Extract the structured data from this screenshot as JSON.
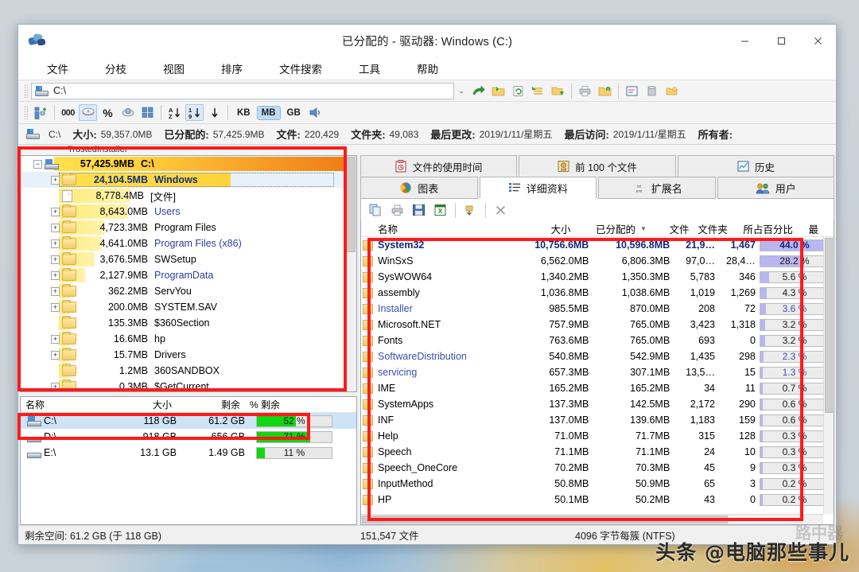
{
  "window": {
    "title": "已分配的 - 驱动器: Windows (C:)",
    "minimize": "—",
    "maximize": "□",
    "close": "✕"
  },
  "menu": [
    "文件",
    "分枝",
    "视图",
    "排序",
    "文件搜索",
    "工具",
    "帮助"
  ],
  "address": {
    "value": "C:\\",
    "caret": "⌄"
  },
  "toolbar": {
    "units": [
      "KB",
      "MB",
      "GB"
    ],
    "active_unit": "MB",
    "numeric_label": "000"
  },
  "infobar": {
    "drive": "C:\\",
    "size_label": "大小:",
    "size_value": "59,357.0MB",
    "alloc_label": "已分配的:",
    "alloc_value": "57,425.9MB",
    "files_label": "文件:",
    "files_value": "220,429",
    "folders_label": "文件夹:",
    "folders_value": "49,083",
    "modified_label": "最后更改:",
    "modified_value": "2019/1/11/星期五",
    "accessed_label": "最后访问:",
    "accessed_value": "2019/1/11/星期五",
    "owner_label": "所有者:",
    "owner_value": "TrustedInstaller"
  },
  "tree": {
    "root": {
      "size": "57,425.9MB",
      "name": "C:\\",
      "bar_pct": 100
    },
    "items": [
      {
        "size": "24,104.5MB",
        "name": "Windows",
        "bar_pct": 72,
        "expandable": true,
        "selected": true,
        "icon": "folder",
        "link": false
      },
      {
        "size": "8,778.4MB",
        "name": "[文件]",
        "bar_pct": 30,
        "expandable": false,
        "selected": false,
        "icon": "file",
        "link": false
      },
      {
        "size": "8,643.0MB",
        "name": "Users",
        "bar_pct": 29,
        "expandable": true,
        "selected": false,
        "icon": "folder",
        "link": true
      },
      {
        "size": "4,723.3MB",
        "name": "Program Files",
        "bar_pct": 19,
        "expandable": true,
        "selected": false,
        "icon": "folder",
        "link": false
      },
      {
        "size": "4,641.0MB",
        "name": "Program Files (x86)",
        "bar_pct": 18,
        "expandable": true,
        "selected": false,
        "icon": "folder",
        "link": true
      },
      {
        "size": "3,676.5MB",
        "name": "SWSetup",
        "bar_pct": 15,
        "expandable": true,
        "selected": false,
        "icon": "folder",
        "link": false
      },
      {
        "size": "2,127.9MB",
        "name": "ProgramData",
        "bar_pct": 11,
        "expandable": true,
        "selected": false,
        "icon": "folder",
        "link": true
      },
      {
        "size": "362.2MB",
        "name": "ServYou",
        "bar_pct": 5,
        "expandable": true,
        "selected": false,
        "icon": "folder",
        "link": false
      },
      {
        "size": "200.0MB",
        "name": "SYSTEM.SAV",
        "bar_pct": 4,
        "expandable": true,
        "selected": false,
        "icon": "folder",
        "link": false
      },
      {
        "size": "135.3MB",
        "name": "$360Section",
        "bar_pct": 3,
        "expandable": false,
        "selected": false,
        "icon": "folder",
        "link": false
      },
      {
        "size": "16.6MB",
        "name": "hp",
        "bar_pct": 2,
        "expandable": true,
        "selected": false,
        "icon": "folder",
        "link": false
      },
      {
        "size": "15.7MB",
        "name": "Drivers",
        "bar_pct": 2,
        "expandable": true,
        "selected": false,
        "icon": "folder",
        "link": false
      },
      {
        "size": "1.2MB",
        "name": "360SANDBOX",
        "bar_pct": 1,
        "expandable": false,
        "selected": false,
        "icon": "folder",
        "link": false
      },
      {
        "size": "0.3MB",
        "name": "$GetCurrent",
        "bar_pct": 1,
        "expandable": true,
        "selected": false,
        "icon": "folder",
        "link": false
      }
    ]
  },
  "drive_list": {
    "headers": [
      "名称",
      "大小",
      "剩余",
      "% 剩余"
    ],
    "rows": [
      {
        "name": "C:\\",
        "size": "118 GB",
        "free": "61.2 GB",
        "pct_text": "52 %",
        "pct": 52,
        "selected": true
      },
      {
        "name": "D:\\",
        "size": "918 GB",
        "free": "656 GB",
        "pct_text": "71 %",
        "pct": 71,
        "selected": false
      },
      {
        "name": "E:\\",
        "size": "13.1 GB",
        "free": "1.49 GB",
        "pct_text": "11 %",
        "pct": 11,
        "selected": false
      }
    ]
  },
  "right_panel": {
    "tabs_top": [
      {
        "label": "文件的使用时间",
        "icon": "clipboard-clock-icon"
      },
      {
        "label": "前 100 个文件",
        "icon": "top100-icon"
      },
      {
        "label": "历史",
        "icon": "history-chart-icon"
      }
    ],
    "tabs_main": [
      {
        "label": "图表",
        "icon": "pie-chart-icon",
        "active": false
      },
      {
        "label": "详细资料",
        "icon": "details-list-icon",
        "active": true
      },
      {
        "label": "扩展名",
        "icon": "file-ext-icon",
        "active": false
      },
      {
        "label": "用户",
        "icon": "users-icon",
        "active": false
      }
    ],
    "mini_toolbar": [
      "copy-icon",
      "print-icon",
      "save-icon",
      "excel-icon",
      "export-icon",
      "close-icon"
    ],
    "grid_headers": [
      "名称",
      "大小",
      "已分配的",
      "文件",
      "文件夹",
      "所占百分比",
      "最"
    ],
    "sort_column": "已分配的",
    "sort_glyph": "▼",
    "rows": [
      {
        "name": "System32",
        "size": "10,756.6MB",
        "alloc": "10,596.8MB",
        "files": "21,9…",
        "folders": "1,467",
        "pct_text": "44.0 %",
        "pct": 44.0
      },
      {
        "name": "WinSxS",
        "size": "6,562.0MB",
        "alloc": "6,806.3MB",
        "files": "97,0…",
        "folders": "28,4…",
        "pct_text": "28.2 %",
        "pct": 28.2
      },
      {
        "name": "SysWOW64",
        "size": "1,340.2MB",
        "alloc": "1,350.3MB",
        "files": "5,783",
        "folders": "346",
        "pct_text": "5.6 %",
        "pct": 5.6
      },
      {
        "name": "assembly",
        "size": "1,036.8MB",
        "alloc": "1,038.6MB",
        "files": "1,019",
        "folders": "1,269",
        "pct_text": "4.3 %",
        "pct": 4.3
      },
      {
        "name": "Installer",
        "size": "985.5MB",
        "alloc": "870.0MB",
        "files": "208",
        "folders": "72",
        "pct_text": "3.6 %",
        "pct": 3.6
      },
      {
        "name": "Microsoft.NET",
        "size": "757.9MB",
        "alloc": "765.0MB",
        "files": "3,423",
        "folders": "1,318",
        "pct_text": "3.2 %",
        "pct": 3.2
      },
      {
        "name": "Fonts",
        "size": "763.6MB",
        "alloc": "765.0MB",
        "files": "693",
        "folders": "0",
        "pct_text": "3.2 %",
        "pct": 3.2
      },
      {
        "name": "SoftwareDistribution",
        "size": "540.8MB",
        "alloc": "542.9MB",
        "files": "1,435",
        "folders": "298",
        "pct_text": "2.3 %",
        "pct": 2.3
      },
      {
        "name": "servicing",
        "size": "657.3MB",
        "alloc": "307.1MB",
        "files": "13,5…",
        "folders": "15",
        "pct_text": "1.3 %",
        "pct": 1.3
      },
      {
        "name": "IME",
        "size": "165.2MB",
        "alloc": "165.2MB",
        "files": "34",
        "folders": "11",
        "pct_text": "0.7 %",
        "pct": 0.7
      },
      {
        "name": "SystemApps",
        "size": "137.3MB",
        "alloc": "142.5MB",
        "files": "2,172",
        "folders": "290",
        "pct_text": "0.6 %",
        "pct": 0.6
      },
      {
        "name": "INF",
        "size": "137.0MB",
        "alloc": "139.6MB",
        "files": "1,183",
        "folders": "159",
        "pct_text": "0.6 %",
        "pct": 0.6
      },
      {
        "name": "Help",
        "size": "71.0MB",
        "alloc": "71.7MB",
        "files": "315",
        "folders": "128",
        "pct_text": "0.3 %",
        "pct": 0.3
      },
      {
        "name": "Speech",
        "size": "71.1MB",
        "alloc": "71.1MB",
        "files": "24",
        "folders": "10",
        "pct_text": "0.3 %",
        "pct": 0.3
      },
      {
        "name": "Speech_OneCore",
        "size": "70.2MB",
        "alloc": "70.3MB",
        "files": "45",
        "folders": "9",
        "pct_text": "0.3 %",
        "pct": 0.3
      },
      {
        "name": "InputMethod",
        "size": "50.8MB",
        "alloc": "50.9MB",
        "files": "65",
        "folders": "3",
        "pct_text": "0.2 %",
        "pct": 0.2
      },
      {
        "name": "HP",
        "size": "50.1MB",
        "alloc": "50.2MB",
        "files": "43",
        "folders": "0",
        "pct_text": "0.2 %",
        "pct": 0.2
      }
    ]
  },
  "statusbar": {
    "free_space": "剩余空间: 61.2 GB  (于 118 GB)",
    "file_count": "151,547  文件",
    "cluster": "4096 字节每簇 (NTFS)"
  },
  "watermark": {
    "text": "头条 @电脑那些事儿",
    "ghost": "路中器"
  },
  "colors": {
    "accent_orange": "#f28c1e",
    "bar_yellow": "#ffe14d",
    "green": "#12d612",
    "purple": "#b9b6ef",
    "annotation_red": "#ff1a1a"
  }
}
